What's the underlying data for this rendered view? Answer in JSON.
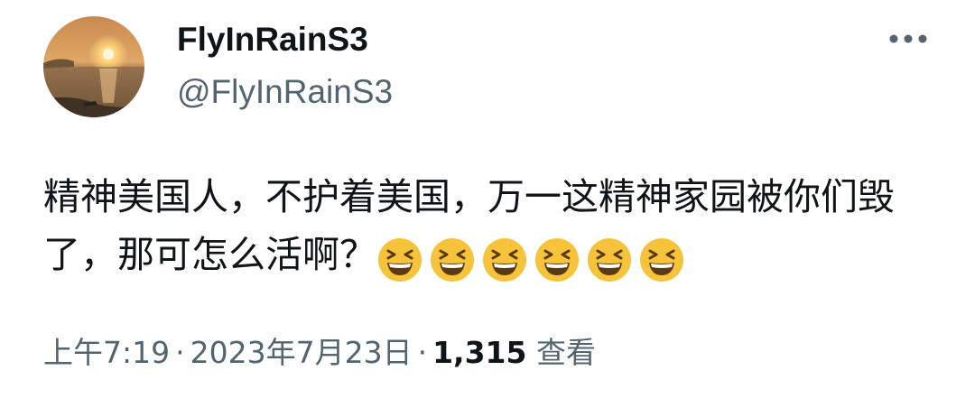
{
  "user": {
    "display_name": "FlyInRainS3",
    "handle": "@FlyInRainS3",
    "avatar": "sunset-sea-avatar"
  },
  "more_menu": {
    "icon": "more-horizontal-icon"
  },
  "tweet": {
    "text": "精神美国人，不护着美国，万一这精神家园被你们毁了，那可怎么活啊？",
    "emojis": [
      "grinning-squinting-face",
      "grinning-squinting-face",
      "grinning-squinting-face",
      "grinning-squinting-face",
      "grinning-squinting-face",
      "grinning-squinting-face"
    ]
  },
  "meta": {
    "time": "上午7:19",
    "separator": "·",
    "date": "2023年7月23日",
    "views_count": "1,315",
    "views_label": "查看"
  },
  "colors": {
    "primary_text": "#0f1419",
    "secondary_text": "#536471",
    "emoji_yellow": "#f6c33a"
  }
}
